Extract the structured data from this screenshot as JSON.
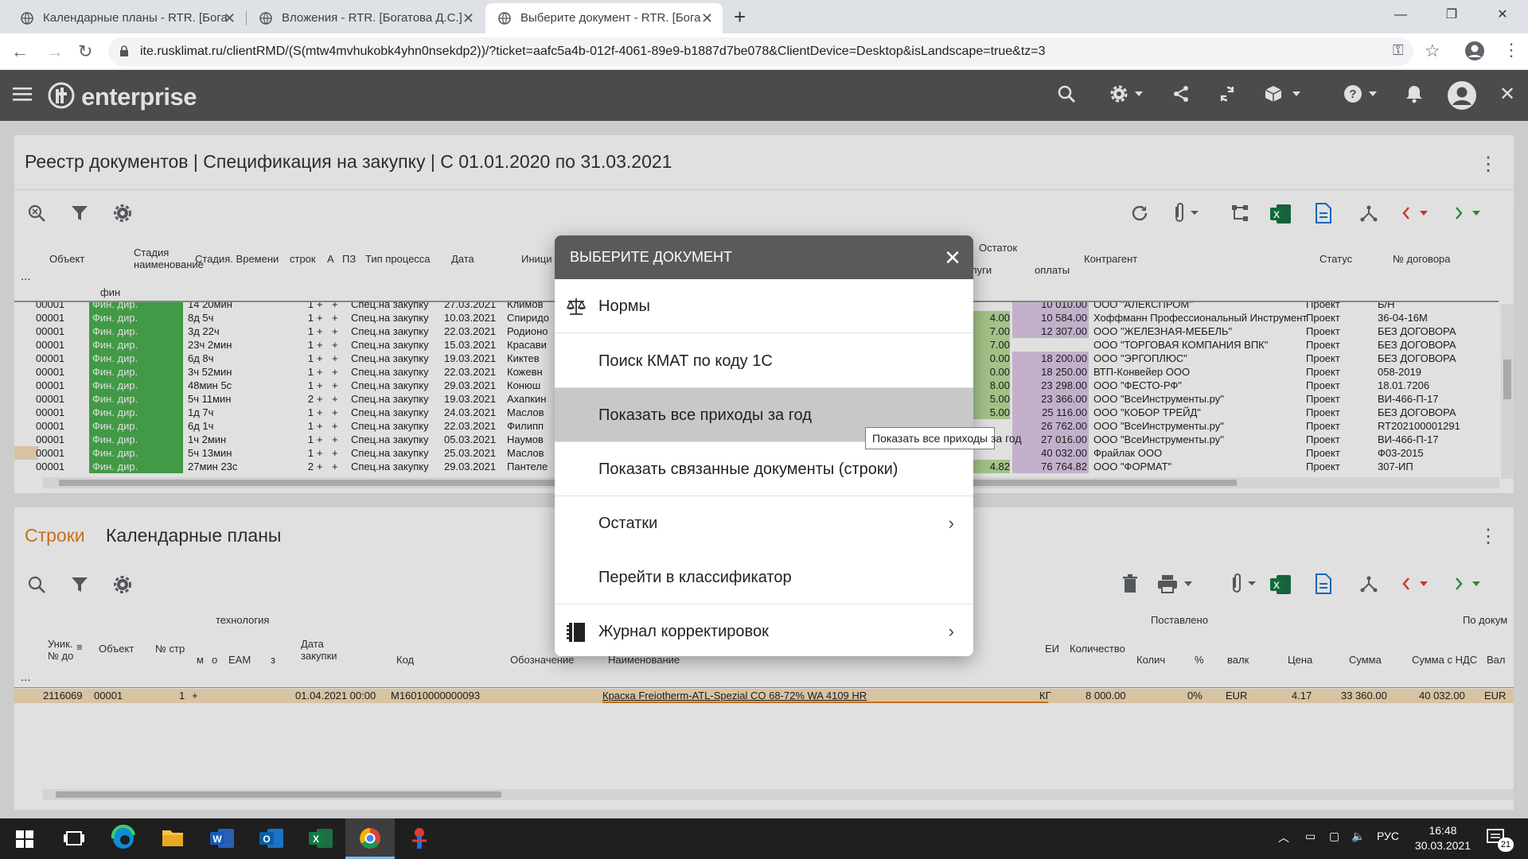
{
  "browser": {
    "tabs": [
      {
        "title": "Календарные планы - RTR. [Бога",
        "active": false
      },
      {
        "title": "Вложения - RTR. [Богатова Д.С.]",
        "active": false
      },
      {
        "title": "Выберите документ - RTR. [Бога",
        "active": true
      }
    ],
    "url": "ite.rusklimat.ru/clientRMD/(S(mtw4mvhukobk4yhn0nsekdp2))/?ticket=aafc5a4b-012f-4061-89e9-b1887d7be078&ClientDevice=Desktop&isLandscape=true&tz=3"
  },
  "app": {
    "logo_text": "enterprise"
  },
  "top_panel": {
    "title": "Реестр документов | Спецификация на закупку | С 01.01.2020 по 31.03.2021",
    "columns": {
      "object": "Объект",
      "stage_name": "Стадия наименование",
      "stage_time": "Стадия. Времени",
      "lines": "строк",
      "a": "А",
      "pz": "ПЗ",
      "process_type": "Тип процесса",
      "date": "Дата",
      "initiator": "Иници",
      "ostatok": "Остаток",
      "uslugi": "луги",
      "oplaty": "оплаты",
      "counterparty": "Контрагент",
      "status": "Статус",
      "contract": "№ договора"
    },
    "filter_dots": "...",
    "filter_fin": "фин",
    "rows": [
      {
        "obj": "00001",
        "stage": "Фин. дир.",
        "time": "14 20мин",
        "n": "1",
        "a": "+",
        "pz": "+",
        "type": "Спец.на закупку",
        "date": "27.03.2021",
        "init": "Климов",
        "rest": "",
        "pay": "10 010.00",
        "cp": "ООО \"АЛЕКСПРОМ\"",
        "status": "Проект",
        "contract": "Б/Н"
      },
      {
        "obj": "00001",
        "stage": "Фин. дир.",
        "time": "8д 5ч",
        "n": "1",
        "a": "+",
        "pz": "+",
        "type": "Спец.на закупку",
        "date": "10.03.2021",
        "init": "Спиридо",
        "rest": "4.00",
        "pay": "10 584.00",
        "cp": "Хоффманн Профессиональный Инструмент",
        "status": "Проект",
        "contract": "36-04-16М"
      },
      {
        "obj": "00001",
        "stage": "Фин. дир.",
        "time": "3д 22ч",
        "n": "1",
        "a": "+",
        "pz": "+",
        "type": "Спец.на закупку",
        "date": "22.03.2021",
        "init": "Родионо",
        "rest": "7.00",
        "pay": "12 307.00",
        "cp": "ООО \"ЖЕЛЕЗНАЯ-МЕБЕЛЬ\"",
        "status": "Проект",
        "contract": "БЕЗ ДОГОВОРА"
      },
      {
        "obj": "00001",
        "stage": "Фин. дир.",
        "time": "23ч 2мин",
        "n": "1",
        "a": "+",
        "pz": "+",
        "type": "Спец.на закупку",
        "date": "15.03.2021",
        "init": "Красави",
        "rest": "7.00",
        "pay": "",
        "cp": "ООО \"ТОРГОВАЯ КОМПАНИЯ ВПК\"",
        "status": "Проект",
        "contract": "БЕЗ ДОГОВОРА"
      },
      {
        "obj": "00001",
        "stage": "Фин. дир.",
        "time": "6д 8ч",
        "n": "1",
        "a": "+",
        "pz": "+",
        "type": "Спец.на закупку",
        "date": "19.03.2021",
        "init": "Киктев",
        "rest": "0.00",
        "pay": "18 200.00",
        "cp": "ООО \"ЭРГОПЛЮС\"",
        "status": "Проект",
        "contract": "БЕЗ ДОГОВОРА"
      },
      {
        "obj": "00001",
        "stage": "Фин. дир.",
        "time": "3ч 52мин",
        "n": "1",
        "a": "+",
        "pz": "+",
        "type": "Спец.на закупку",
        "date": "22.03.2021",
        "init": "Кожевн",
        "rest": "0.00",
        "pay": "18 250.00",
        "cp": "ВТП-Конвейер ООО",
        "status": "Проект",
        "contract": "058-2019"
      },
      {
        "obj": "00001",
        "stage": "Фин. дир.",
        "time": "48мин 5с",
        "n": "1",
        "a": "+",
        "pz": "+",
        "type": "Спец.на закупку",
        "date": "29.03.2021",
        "init": "Конюш",
        "rest": "8.00",
        "pay": "23 298.00",
        "cp": "ООО \"ФЕСТО-РФ\"",
        "status": "Проект",
        "contract": "18.01.7206"
      },
      {
        "obj": "00001",
        "stage": "Фин. дир.",
        "time": "5ч 11мин",
        "n": "2",
        "a": "+",
        "pz": "+",
        "type": "Спец.на закупку",
        "date": "19.03.2021",
        "init": "Ахапкин",
        "rest": "5.00",
        "pay": "23 366.00",
        "cp": "ООО \"ВсеИнструменты.ру\"",
        "status": "Проект",
        "contract": "ВИ-466-П-17"
      },
      {
        "obj": "00001",
        "stage": "Фин. дир.",
        "time": "1д 7ч",
        "n": "1",
        "a": "+",
        "pz": "+",
        "type": "Спец.на закупку",
        "date": "24.03.2021",
        "init": "Маслов",
        "rest": "5.00",
        "pay": "25 116.00",
        "cp": "ООО \"КОБОР ТРЕЙД\"",
        "status": "Проект",
        "contract": "БЕЗ ДОГОВОРА"
      },
      {
        "obj": "00001",
        "stage": "Фин. дир.",
        "time": "6д 1ч",
        "n": "1",
        "a": "+",
        "pz": "+",
        "type": "Спец.на закупку",
        "date": "22.03.2021",
        "init": "Филипп",
        "rest": "",
        "pay": "26 762.00",
        "cp": "ООО \"ВсеИнструменты.ру\"",
        "status": "Проект",
        "contract": "RT202100001291"
      },
      {
        "obj": "00001",
        "stage": "Фин. дир.",
        "time": "1ч 2мин",
        "n": "1",
        "a": "+",
        "pz": "+",
        "type": "Спец.на закупку",
        "date": "05.03.2021",
        "init": "Наумов",
        "rest": "",
        "pay": "27 016.00",
        "cp": "ООО \"ВсеИнструменты.ру\"",
        "status": "Проект",
        "contract": "ВИ-466-П-17"
      },
      {
        "obj": "00001",
        "stage": "Фин. дир.",
        "time": "5ч 13мин",
        "n": "1",
        "a": "+",
        "pz": "+",
        "type": "Спец.на закупку",
        "date": "25.03.2021",
        "init": "Маслов",
        "rest": "",
        "pay": "40 032.00",
        "cp": "Фрайлак ООО",
        "status": "Проект",
        "contract": "Ф03-2015"
      },
      {
        "obj": "00001",
        "stage": "Фин. дир.",
        "time": "27мин 23с",
        "n": "2",
        "a": "+",
        "pz": "+",
        "type": "Спец.на закупку",
        "date": "29.03.2021",
        "init": "Пантеле",
        "rest": "4.82",
        "pay": "76 764.82",
        "cp": "ООО \"ФОРМАТ\"",
        "status": "Проект",
        "contract": "307-ИП"
      }
    ]
  },
  "bottom_panel": {
    "tab_active": "Строки",
    "tab_inactive": "Календарные планы",
    "group_tech": "технология",
    "group_delivered": "Поставлено",
    "group_by_doc": "По докум",
    "columns": {
      "uniq": "Уник. № до",
      "object": "Объект",
      "line_no": "№ стр",
      "m": "м",
      "o": "о",
      "eam": "ЕАМ",
      "z": "з",
      "buy_date": "Дата закупки",
      "code": "Код",
      "designation": "Обозначение",
      "name": "Наименование",
      "unit": "ЕИ",
      "qty": "Количество",
      "qty2": "Колич",
      "pct": "%",
      "currency": "валк",
      "price": "Цена",
      "sum": "Сумма",
      "sum_vat": "Сумма с НДС",
      "val": "Вал"
    },
    "filter_dots": "...",
    "row": {
      "uniq": "2116069",
      "object": "00001",
      "line_no": "1",
      "m": "+",
      "buy_date": "01.04.2021 00:00",
      "code": "M16010000000093",
      "name": "Краска Freiotherm-ATL-Spezial CO 68-72% WA 4109 HR",
      "unit": "КГ",
      "qty": "8 000.00",
      "pct": "0%",
      "currency": "EUR",
      "price": "4.17",
      "sum": "33 360.00",
      "sum_vat": "40 032.00",
      "val": "EUR"
    }
  },
  "dialog": {
    "title": "ВЫБЕРИТЕ ДОКУМЕНТ",
    "items": [
      {
        "label": "Нормы",
        "icon": "scales-icon",
        "submenu": false
      },
      {
        "label": "Поиск КМАТ по коду 1С",
        "icon": "",
        "submenu": false
      },
      {
        "label": "Показать все приходы за год",
        "icon": "",
        "submenu": false,
        "hovered": true
      },
      {
        "label": "Показать связанные документы (строки)",
        "icon": "",
        "submenu": false
      },
      {
        "label": "Остатки",
        "icon": "",
        "submenu": true
      },
      {
        "label": "Перейти в классификатор",
        "icon": "",
        "submenu": false
      },
      {
        "label": "Журнал корректировок",
        "icon": "journal-icon",
        "submenu": true
      }
    ],
    "tooltip": "Показать все приходы за год"
  },
  "taskbar": {
    "lang": "РУС",
    "time": "16:48",
    "date": "30.03.2021",
    "notifications": "21"
  },
  "colors": {
    "header_bg": "#555656",
    "stage_green": "#4caf50",
    "accent_orange": "#e67e22",
    "sum_purple": "#ddc9e8"
  }
}
